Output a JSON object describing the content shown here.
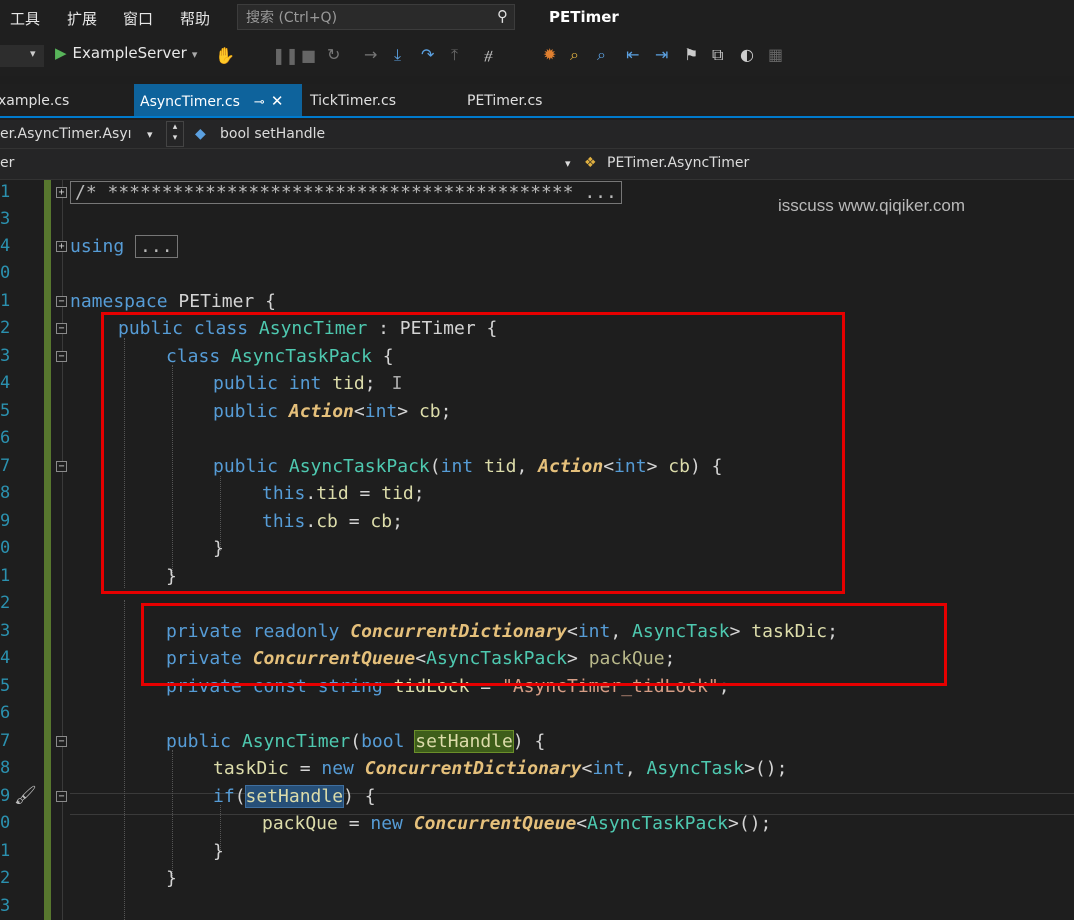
{
  "menu": [
    "工具",
    "扩展",
    "窗口",
    "帮助"
  ],
  "search": {
    "placeholder": "搜索 (Ctrl+Q)"
  },
  "app_title": "PETimer",
  "toolbar": {
    "run_label": "ExampleServer"
  },
  "tabs": [
    {
      "label": "xample.cs",
      "active": false
    },
    {
      "label": "AsyncTimer.cs",
      "active": true
    },
    {
      "label": "TickTimer.cs",
      "active": false
    },
    {
      "label": "PETimer.cs",
      "active": false
    }
  ],
  "nav": {
    "member_scope": "er.AsyncTimer.Asyı",
    "member": "bool setHandle",
    "left_scope": "er",
    "class_scope": "PETimer.AsyncTimer"
  },
  "watermark": "isscuss www.qiqiker.com",
  "line_numbers": [
    "1",
    "3",
    "4",
    "0",
    "1",
    "2",
    "3",
    "4",
    "5",
    "6",
    "7",
    "8",
    "9",
    "0",
    "1",
    "2",
    "3",
    "4",
    "5",
    "6",
    "7",
    "8",
    "9",
    "0",
    "1",
    "2",
    "3"
  ],
  "code": {
    "header_comment": "/* ******************************************* ...",
    "using": "using",
    "collapsed": "...",
    "ns_kw": "namespace",
    "ns_name": "PETimer",
    "class_decl": [
      "public",
      "class",
      "AsyncTimer",
      "PETimer"
    ],
    "inner_class": [
      "class",
      "AsyncTaskPack"
    ],
    "field_tid": [
      "public",
      "int",
      "tid"
    ],
    "field_cb": [
      "public",
      "Action",
      "int",
      "cb"
    ],
    "ctor_pack": [
      "public",
      "AsyncTaskPack",
      "int",
      "tid",
      "Action",
      "int",
      "cb"
    ],
    "assign_tid": [
      "this",
      "tid",
      "tid"
    ],
    "assign_cb": [
      "this",
      "cb",
      "cb"
    ],
    "field_taskdic": [
      "private",
      "readonly",
      "ConcurrentDictionary",
      "int",
      "AsyncTask",
      "taskDic"
    ],
    "field_packque": [
      "private",
      "ConcurrentQueue",
      "AsyncTaskPack",
      "packQue"
    ],
    "field_lock": [
      "private",
      "const",
      "string",
      "tidLock",
      "\"AsyncTimer_tidLock\""
    ],
    "ctor_timer": [
      "public",
      "AsyncTimer",
      "bool",
      "setHandle"
    ],
    "new_taskdic": [
      "taskDic",
      "new",
      "ConcurrentDictionary",
      "int",
      "AsyncTask"
    ],
    "if_stmt": [
      "if",
      "setHandle"
    ],
    "new_packque": [
      "packQue",
      "new",
      "ConcurrentQueue",
      "AsyncTaskPack"
    ]
  }
}
